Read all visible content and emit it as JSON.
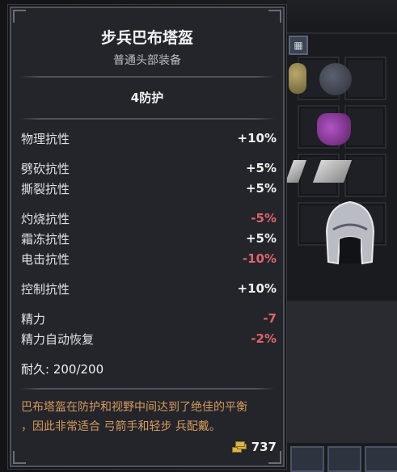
{
  "item": {
    "name": "步兵巴布塔盔",
    "type": "普通头部装备",
    "armor": "4防护",
    "stats_group1": [
      {
        "label": "物理抗性",
        "value": "+10%",
        "sign": "pos"
      }
    ],
    "stats_group2": [
      {
        "label": "劈砍抗性",
        "value": "+5%",
        "sign": "pos"
      },
      {
        "label": "撕裂抗性",
        "value": "+5%",
        "sign": "pos"
      }
    ],
    "stats_group3": [
      {
        "label": "灼烧抗性",
        "value": "-5%",
        "sign": "neg"
      },
      {
        "label": "霜冻抗性",
        "value": "+5%",
        "sign": "pos"
      },
      {
        "label": "电击抗性",
        "value": "-10%",
        "sign": "neg"
      }
    ],
    "stats_group4": [
      {
        "label": "控制抗性",
        "value": "+10%",
        "sign": "pos"
      }
    ],
    "stats_group5": [
      {
        "label": "精力",
        "value": "-7",
        "sign": "neg"
      },
      {
        "label": "精力自动恢复",
        "value": "-2%",
        "sign": "neg"
      }
    ],
    "durability": "耐久: 200/200",
    "description_line1": "巴布塔盔在防护和视野中间达到了绝佳的平衡",
    "description_line2": "，因此非常适合 弓箭手和轻步 兵配戴。",
    "price": "737",
    "price_icon": "gold-coins-icon"
  },
  "colors": {
    "positive": "#f2f2f2",
    "negative": "#e0646a",
    "description": "#d79a5c"
  }
}
